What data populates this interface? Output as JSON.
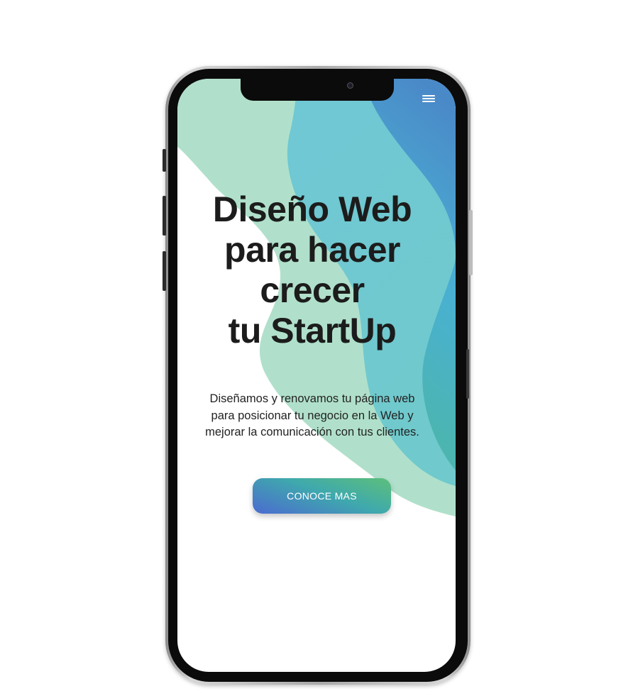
{
  "header": {
    "menu_icon": "hamburger-menu-icon"
  },
  "hero": {
    "title_lines": [
      "Diseño Web",
      "para hacer",
      "crecer",
      "tu StartUp"
    ],
    "subtitle_lines": [
      "Diseñamos y renovamos tu página web",
      "para posicionar tu negocio en la Web y",
      "mejorar la comunicación con tus clientes."
    ],
    "cta_label": "CONOCE MAS"
  },
  "colors": {
    "wave_light": "#b0e0cb",
    "wave_teal": "#6fc8d5",
    "wave_blue": "#4aa0d6",
    "button_green": "#5dbf7a",
    "button_blue": "#4b6bd0",
    "text_dark": "#1c1c1c"
  }
}
